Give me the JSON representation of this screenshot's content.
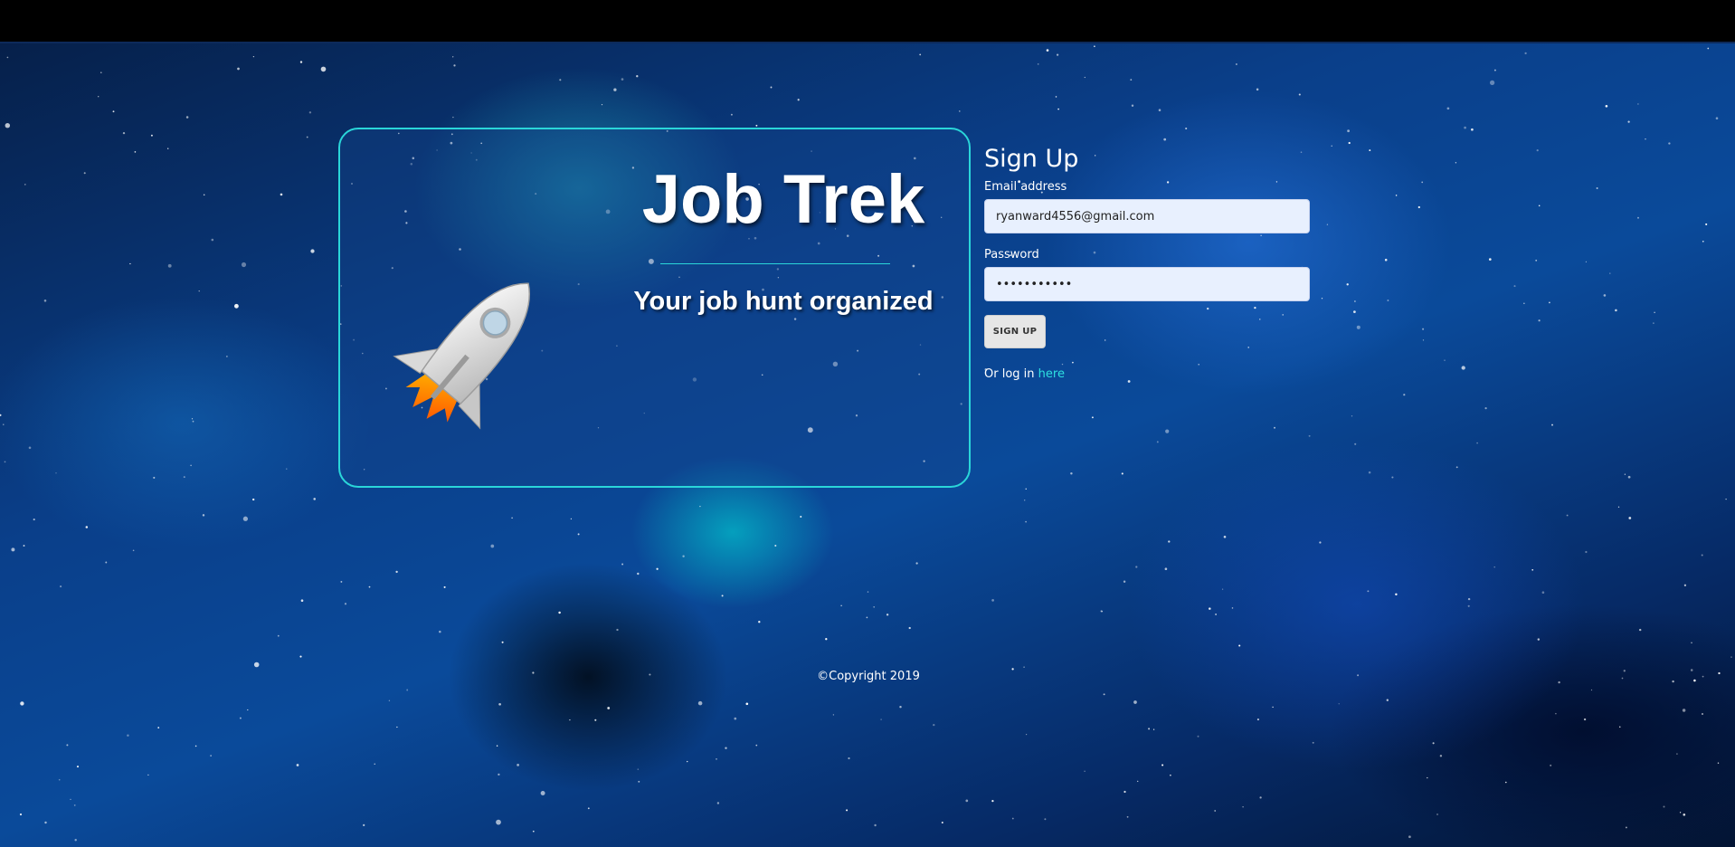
{
  "hero": {
    "title": "Job Trek",
    "tagline": "Your job hunt organized",
    "icon": "rocket-icon"
  },
  "signup": {
    "title": "Sign Up",
    "email_label": "Email address",
    "email_value": "ryanward4556@gmail.com",
    "password_label": "Password",
    "password_value": "•••••••••••",
    "button_label": "SIGN UP",
    "login_prefix": "Or log in ",
    "login_link": "here"
  },
  "footer": {
    "copyright": "©Copyright 2019"
  },
  "colors": {
    "accent": "#2ad6d9",
    "input_bg": "#e8f0fe",
    "button_bg": "#e6e6e6"
  }
}
